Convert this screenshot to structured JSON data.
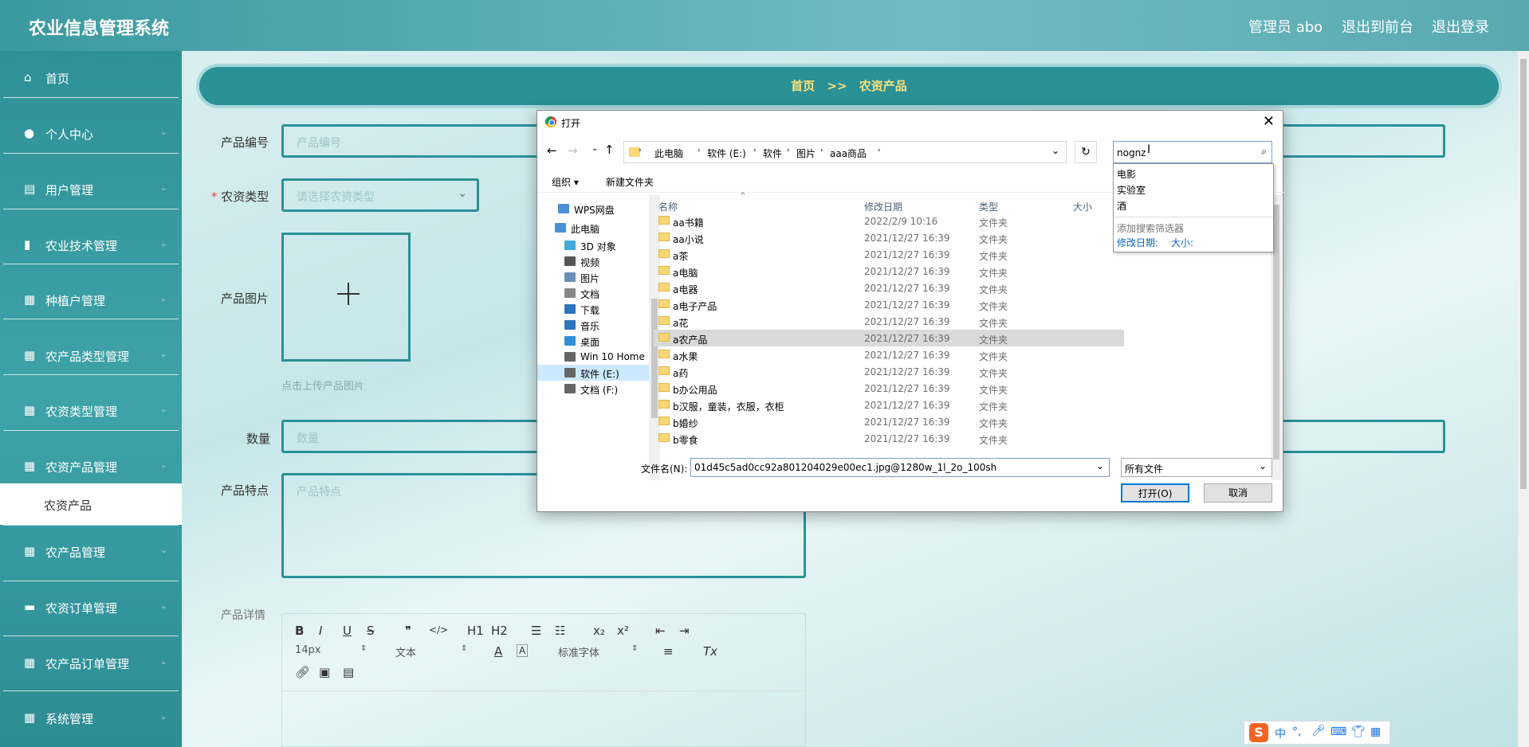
{
  "app": {
    "title": "农业信息管理系统",
    "admin_label": "管理员 abo",
    "front_link": "退出到前台",
    "logout_link": "退出登录"
  },
  "sidebar": {
    "items": [
      {
        "label": "首页",
        "icon": "home-icon"
      },
      {
        "label": "个人中心",
        "icon": "person-icon"
      },
      {
        "label": "用户管理",
        "icon": "clipboard-icon"
      },
      {
        "label": "农业技术管理",
        "icon": "bar-chart-icon"
      },
      {
        "label": "种植户管理",
        "icon": "grid-icon"
      },
      {
        "label": "农产品类型管理",
        "icon": "grid-icon"
      },
      {
        "label": "农资类型管理",
        "icon": "grid-icon"
      },
      {
        "label": "农资产品管理",
        "icon": "grid-icon"
      },
      {
        "label": "农产品管理",
        "icon": "grid-icon"
      },
      {
        "label": "农资订单管理",
        "icon": "monitor-icon"
      },
      {
        "label": "农产品订单管理",
        "icon": "grid-icon"
      },
      {
        "label": "系统管理",
        "icon": "grid-icon"
      }
    ],
    "submenu_active": "农资产品"
  },
  "breadcrumb": {
    "home": "首页",
    "sep": ">>",
    "current": "农资产品"
  },
  "form": {
    "code_label": "产品编号",
    "code_placeholder": "产品编号",
    "type_label": "农资类型",
    "type_required": "*",
    "type_placeholder": "请选择农资类型",
    "image_label": "产品图片",
    "image_hint": "点击上传产品图片",
    "qty_label": "数量",
    "qty_placeholder": "数量",
    "feature_label": "产品特点",
    "feature_placeholder": "产品特点",
    "detail_label": "产品详情"
  },
  "editor": {
    "bold": "B",
    "italic": "I",
    "underline": "U",
    "strike": "S",
    "quote": "❞",
    "code": "</>",
    "h1": "H1",
    "h2": "H2",
    "sub": "x₂",
    "sup": "x²",
    "font_size": "14px",
    "block": "文本",
    "font": "标准字体",
    "clear": "Tx"
  },
  "dialog": {
    "title": "打开",
    "path": [
      "此电脑",
      "软件 (E:)",
      "软件",
      "图片",
      "aaa商品"
    ],
    "search_value": "nognz",
    "suggestions": [
      "电影",
      "实验室",
      "酒"
    ],
    "add_filter": "添加搜索筛选器",
    "filter_date": "修改日期:",
    "filter_size": "大小:",
    "organize": "组织 ▾",
    "new_folder": "新建文件夹",
    "tree": [
      "WPS网盘",
      "此电脑",
      "3D 对象",
      "视频",
      "图片",
      "文档",
      "下载",
      "音乐",
      "桌面",
      "Win 10 Home x",
      "软件 (E:)",
      "文档 (F:)"
    ],
    "columns": {
      "name": "名称",
      "date": "修改日期",
      "type": "类型",
      "size": "大小"
    },
    "files": [
      {
        "name": "aa书籍",
        "date": "2022/2/9 10:16",
        "type": "文件夹"
      },
      {
        "name": "aa小说",
        "date": "2021/12/27 16:39",
        "type": "文件夹"
      },
      {
        "name": "a茶",
        "date": "2021/12/27 16:39",
        "type": "文件夹"
      },
      {
        "name": "a电脑",
        "date": "2021/12/27 16:39",
        "type": "文件夹"
      },
      {
        "name": "a电器",
        "date": "2021/12/27 16:39",
        "type": "文件夹"
      },
      {
        "name": "a电子产品",
        "date": "2021/12/27 16:39",
        "type": "文件夹"
      },
      {
        "name": "a花",
        "date": "2021/12/27 16:39",
        "type": "文件夹"
      },
      {
        "name": "a农产品",
        "date": "2021/12/27 16:39",
        "type": "文件夹"
      },
      {
        "name": "a水果",
        "date": "2021/12/27 16:39",
        "type": "文件夹"
      },
      {
        "name": "a药",
        "date": "2021/12/27 16:39",
        "type": "文件夹"
      },
      {
        "name": "b办公用品",
        "date": "2021/12/27 16:39",
        "type": "文件夹"
      },
      {
        "name": "b汉服，童装，衣服，衣柜",
        "date": "2021/12/27 16:39",
        "type": "文件夹"
      },
      {
        "name": "b婚纱",
        "date": "2021/12/27 16:39",
        "type": "文件夹"
      },
      {
        "name": "b零食",
        "date": "2021/12/27 16:39",
        "type": "文件夹"
      }
    ],
    "selected_index": 7,
    "filename_label": "文件名(N):",
    "filename_value": "01d45c5ad0cc92a801204029e00ec1.jpg@1280w_1l_2o_100sh",
    "filetype_value": "所有文件",
    "open_button": "打开(O)",
    "cancel_button": "取消"
  },
  "ime": {
    "logo": "S",
    "mode": "中"
  }
}
